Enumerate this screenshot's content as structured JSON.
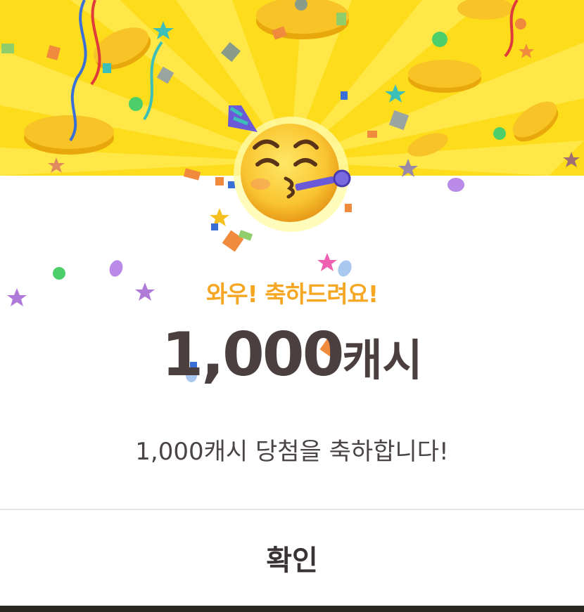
{
  "dialog": {
    "headline": "와우! 축하드려요!",
    "amount_number": "1,000",
    "amount_unit": "캐시",
    "message": "1,000캐시 당첨을 축하합니다!",
    "confirm_label": "확인"
  },
  "colors": {
    "banner_yellow": "#fddc1c",
    "headline_orange": "#f5a623",
    "amount_text": "#4b3f3f",
    "body_text": "#4a4444"
  },
  "icons": [
    "party-face-emoji",
    "gold-coin-icon",
    "confetti",
    "streamer",
    "star-icon"
  ]
}
